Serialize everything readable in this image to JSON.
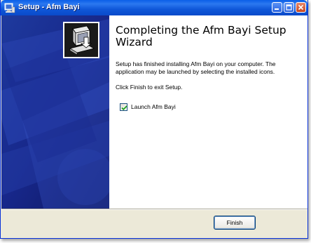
{
  "window": {
    "title": "Setup - Afm Bayi"
  },
  "colors": {
    "titlebar": "#0a5fe8",
    "dialog_bg": "#ece9d8",
    "side_panel": "#1a2a8a",
    "check": "#21a121"
  },
  "icons": {
    "app": "setup-icon",
    "minimize": "minimize-icon",
    "maximize": "maximize-icon",
    "close": "close-icon",
    "wizard": "installer-computer-icon",
    "check": "checkmark-icon"
  },
  "main": {
    "heading": "Completing the Afm Bayi Setup Wizard",
    "paragraph1": "Setup has finished installing Afm Bayi on your computer. The application may be launched by selecting the installed icons.",
    "paragraph2": "Click Finish to exit Setup.",
    "launch_checkbox": {
      "label": "Launch Afm Bayi",
      "checked": true
    }
  },
  "footer": {
    "finish_label": "Finish"
  }
}
